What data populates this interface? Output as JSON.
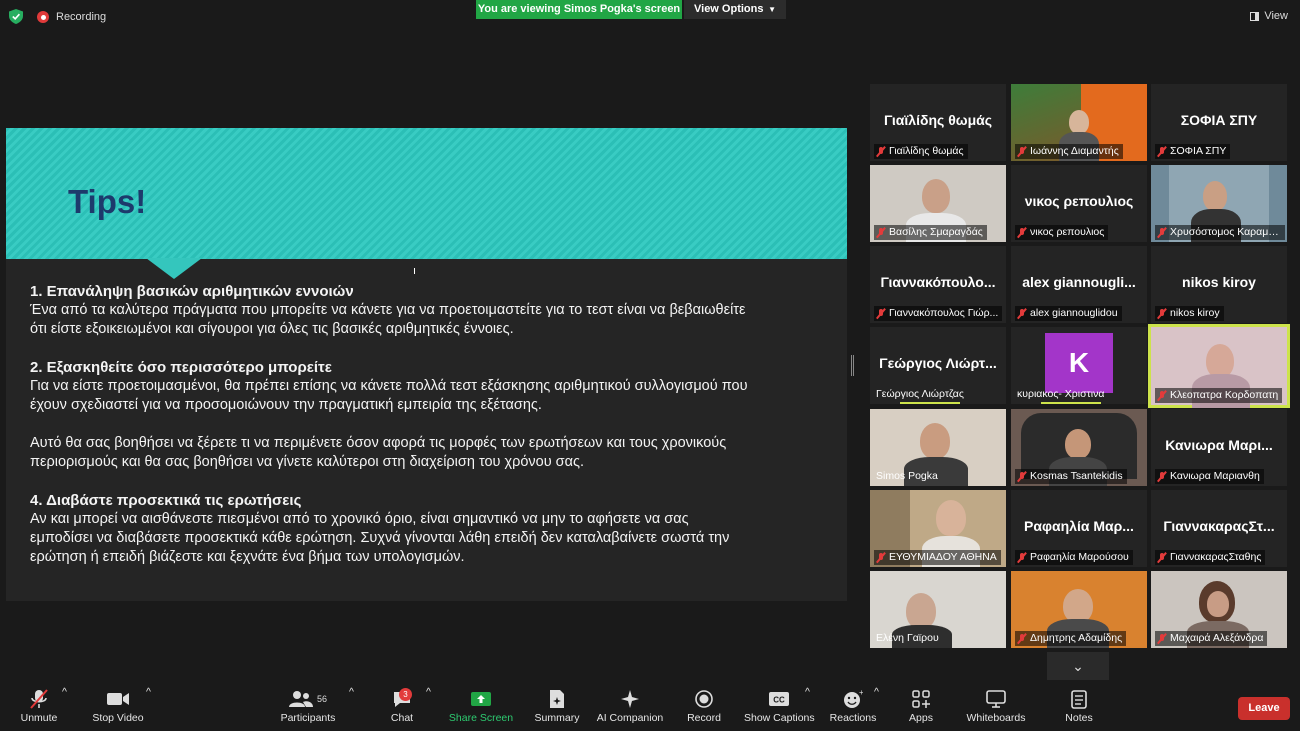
{
  "topbar": {
    "recording": "Recording",
    "viewing_banner": "You are viewing Simos Pogka's screen",
    "view_options": "View Options",
    "view": "View"
  },
  "slide": {
    "title": "Tips!",
    "s1_heading": "1. Επανάληψη βασικών αριθμητικών εννοιών",
    "s1_line1": "Ένα από τα καλύτερα πράγματα που μπορείτε να κάνετε για να προετοιμαστείτε για το τεστ είναι να βεβαιωθείτε",
    "s1_line2": "ότι είστε εξοικειωμένοι και σίγουροι για όλες τις βασικές αριθμητικές έννοιες.",
    "s2_heading": "2. Εξασκηθείτε όσο περισσότερο μπορείτε",
    "s2_line1": "Για να είστε προετοιμασμένοι, θα πρέπει επίσης να κάνετε πολλά τεστ εξάσκησης αριθμητικού συλλογισμού που",
    "s2_line2": "έχουν σχεδιαστεί για να προσομοιώνουν την πραγματική εμπειρία της εξέτασης.",
    "s3_line1": "Αυτό θα σας βοηθήσει να ξέρετε τι να περιμένετε όσον αφορά τις μορφές των ερωτήσεων και τους χρονικούς",
    "s3_line2": "περιορισμούς και θα σας βοηθήσει να γίνετε καλύτεροι στη διαχείριση του χρόνου σας.",
    "s4_heading": "4. Διαβάστε προσεκτικά τις ερωτήσεις",
    "s4_line1": "Αν και μπορεί να αισθάνεστε πιεσμένοι από το χρονικό όριο, είναι σημαντικό να μην το αφήσετε να σας",
    "s4_line2": "εμποδίσει να διαβάσετε προσεκτικά κάθε ερώτηση. Συχνά γίνονται λάθη επειδή δεν καταλαβαίνετε σωστά την",
    "s4_line3": "ερώτηση ή επειδή βιάζεστε και ξεχνάτε ένα βήμα των υπολογισμών."
  },
  "participants": [
    {
      "big": "Γιαϊλίδης θωμάς",
      "label": "Γιαϊλίδης θωμάς"
    },
    {
      "big": "",
      "label": "Ιωάννης Διαμαντής"
    },
    {
      "big": "ΣΟΦΙΑ ΣΠΥ",
      "label": "ΣΟΦΙΑ ΣΠΥ"
    },
    {
      "big": "",
      "label": "Βασίλης Σμαραγδάς"
    },
    {
      "big": "νικος ρεπουλιος",
      "label": "νικος ρεπουλιος"
    },
    {
      "big": "",
      "label": "Χρυσόστομος Καραμα..."
    },
    {
      "big": "Γιαννακόπουλο...",
      "label": "Γιαννακόπουλος Γιώρ..."
    },
    {
      "big": "alex giannougli...",
      "label": "alex giannouglidou"
    },
    {
      "big": "nikos kiroy",
      "label": "nikos kiroy"
    },
    {
      "big": "Γεώργιος Λιώρτ...",
      "label": "Γεώργιος Λιώρτζας"
    },
    {
      "big": "K",
      "label": "κυριακος- Χριστινα"
    },
    {
      "big": "",
      "label": "Κλεοπατρα Κορδοπατη"
    },
    {
      "big": "",
      "label": "Simos Pogka"
    },
    {
      "big": "",
      "label": "Kosmas Tsantekidis"
    },
    {
      "big": "Κανιωρα Μαρι...",
      "label": "Κανιωρα Μαριανθη"
    },
    {
      "big": "",
      "label": "ΕΥΘΥΜΙΑΔΟΥ ΑΘΗΝΑ"
    },
    {
      "big": "Ραφαηλία Μαρ...",
      "label": "Ραφαηλία Μαρούσου"
    },
    {
      "big": "ΓιαννακαραςΣτ...",
      "label": "ΓιαννακαραςΣταθης"
    },
    {
      "big": "",
      "label": "Ελένη Γαϊρου"
    },
    {
      "big": "",
      "label": "Δημητρης Αδαμίδης"
    },
    {
      "big": "",
      "label": "Μαχαιρά Αλεξάνδρα"
    }
  ],
  "toolbar": {
    "unmute": "Unmute",
    "stop_video": "Stop Video",
    "participants": "Participants",
    "participants_count": "56",
    "chat": "Chat",
    "chat_badge": "3",
    "share_screen": "Share Screen",
    "summary": "Summary",
    "ai_companion": "AI Companion",
    "record": "Record",
    "show_captions": "Show Captions",
    "reactions": "Reactions",
    "apps": "Apps",
    "whiteboards": "Whiteboards",
    "notes": "Notes",
    "leave": "Leave"
  },
  "colors": {
    "accent_green": "#21a645",
    "leave_red": "#c9302c",
    "banner_teal": "#2bbfb6",
    "active_speaker": "#cde34b"
  }
}
